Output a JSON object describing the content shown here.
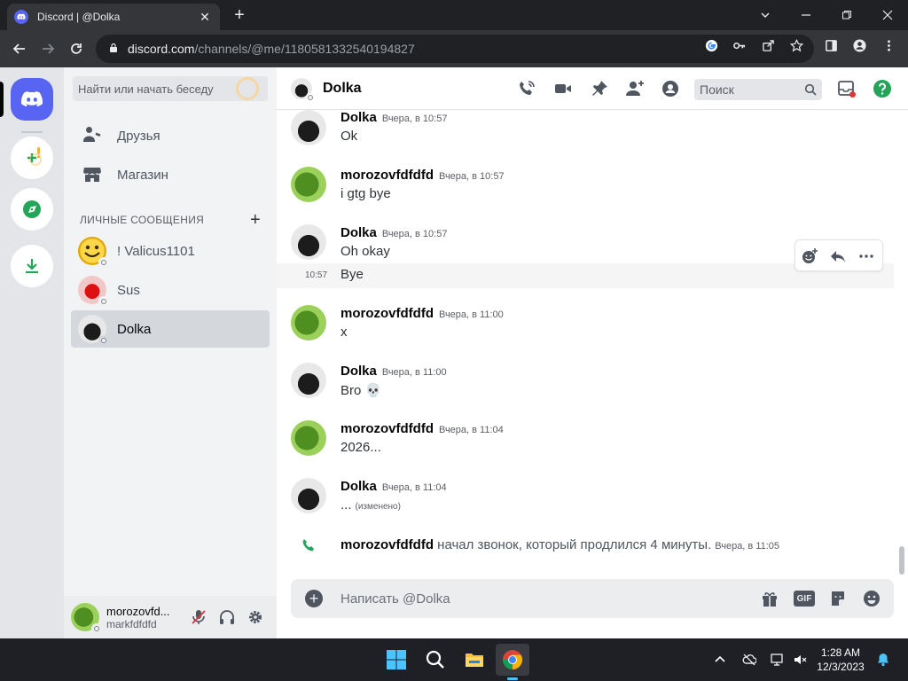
{
  "browser": {
    "tab_title": "Discord | @Dolka",
    "url_host": "discord.com",
    "url_path": "/channels/@me/1180581332540194827"
  },
  "sidebar": {
    "search_placeholder": "Найти или начать беседу",
    "nav": [
      {
        "label": "Друзья",
        "icon": "friends-icon"
      },
      {
        "label": "Магазин",
        "icon": "shop-icon"
      }
    ],
    "dm_header": "ЛИЧНЫЕ СООБЩЕНИЯ",
    "dms": [
      {
        "name": "! Valicus1101",
        "active": false
      },
      {
        "name": "Sus",
        "active": false
      },
      {
        "name": "Dolka",
        "active": true
      }
    ],
    "user": {
      "name": "morozovfd...",
      "tag": "markfdfdfd"
    }
  },
  "chat": {
    "channel_name": "Dolka",
    "search_placeholder": "Поиск",
    "messages": [
      {
        "author": "Dolka",
        "time": "Вчера, в 10:57",
        "text": "Ok"
      },
      {
        "author": "morozovfdfdfd",
        "time": "Вчера, в 10:57",
        "text": "i gtg bye"
      },
      {
        "author": "Dolka",
        "time": "Вчера, в 10:57",
        "text": "Oh okay",
        "followup_time": "10:57",
        "followup": "Bye"
      },
      {
        "author": "morozovfdfdfd",
        "time": "Вчера, в 11:00",
        "text": "x"
      },
      {
        "author": "Dolka",
        "time": "Вчера, в 11:00",
        "text": "Bro 💀"
      },
      {
        "author": "morozovfdfdfd",
        "time": "Вчера, в 11:04",
        "text": "2026..."
      },
      {
        "author": "Dolka",
        "time": "Вчера, в 11:04",
        "text": "...",
        "edited": "(изменено)"
      }
    ],
    "system": {
      "user": "morozovfdfdfd",
      "text": "начал звонок, который продлился 4 минуты.",
      "time": "Вчера, в 11:05"
    },
    "composer_placeholder": "Написать @Dolka",
    "gif_label": "GIF"
  },
  "taskbar": {
    "time": "1:28 AM",
    "date": "12/3/2023"
  },
  "colors": {
    "blurple": "#5865f2",
    "green": "#23a55a",
    "help": "#23a559"
  }
}
